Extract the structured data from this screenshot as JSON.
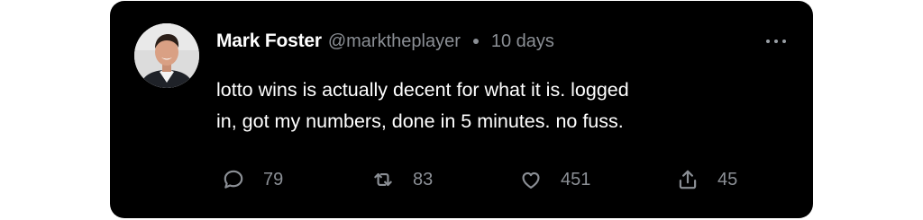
{
  "tweet": {
    "author_name": "Mark Foster",
    "author_handle": "@marktheplayer",
    "time_ago": "10 days",
    "text_lines": [
      "lotto wins is actually decent for what it is. logged",
      "in, got my numbers, done in 5 minutes. no fuss."
    ],
    "more_icon": "more-horizontal-icon",
    "actions": {
      "reply": {
        "icon": "reply-bubble-icon",
        "count": "79"
      },
      "retweet": {
        "icon": "retweet-icon",
        "count": "83"
      },
      "like": {
        "icon": "heart-icon",
        "count": "451"
      },
      "share": {
        "icon": "share-upload-icon",
        "count": "45"
      }
    }
  },
  "colors": {
    "card_background": "#000000",
    "text_primary": "#ffffff",
    "text_secondary": "#8b8f95"
  }
}
